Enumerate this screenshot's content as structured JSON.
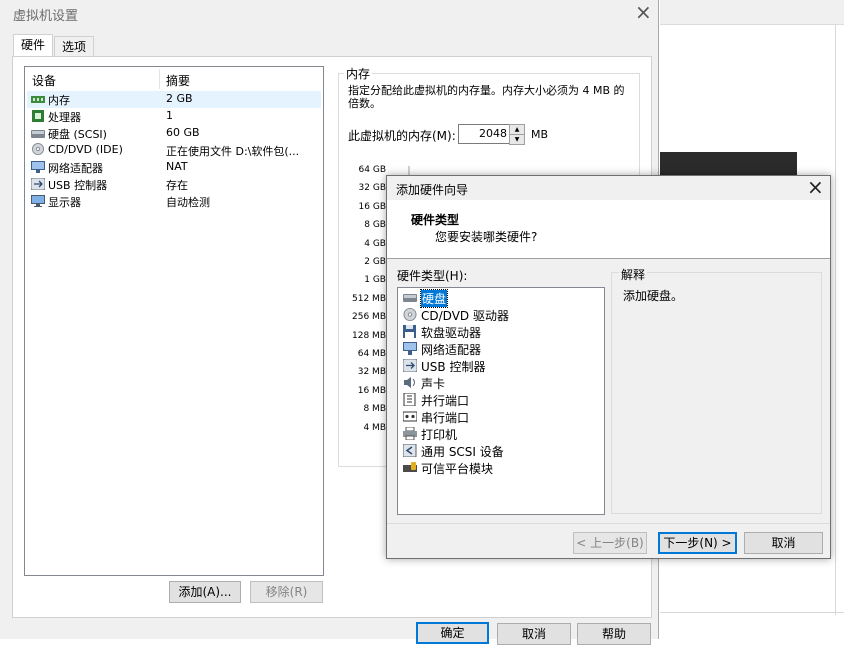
{
  "settings_dialog": {
    "title": "虚拟机设置",
    "tabs": [
      "硬件",
      "选项"
    ],
    "table_headers": {
      "device": "设备",
      "summary": "摘要"
    },
    "devices": [
      {
        "name": "内存",
        "summary": "2 GB",
        "icon": "memory-icon"
      },
      {
        "name": "处理器",
        "summary": "1",
        "icon": "cpu-icon"
      },
      {
        "name": "硬盘 (SCSI)",
        "summary": "60 GB",
        "icon": "harddisk-icon"
      },
      {
        "name": "CD/DVD (IDE)",
        "summary": "正在使用文件 D:\\软件包(...",
        "icon": "cdrom-icon"
      },
      {
        "name": "网络适配器",
        "summary": "NAT",
        "icon": "network-icon"
      },
      {
        "name": "USB 控制器",
        "summary": "存在",
        "icon": "usb-icon"
      },
      {
        "name": "显示器",
        "summary": "自动检测",
        "icon": "display-icon"
      }
    ],
    "add_button": "添加(A)...",
    "remove_button": "移除(R)",
    "ok_button": "确定",
    "cancel_button": "取消",
    "help_button": "帮助",
    "memory": {
      "group_title": "内存",
      "description": "指定分配给此虚拟机的内存量。内存大小必须为 4 MB 的倍数。",
      "field_label": "此虚拟机的内存(M):",
      "value": "2048",
      "unit": "MB",
      "scale_labels": [
        "64 GB",
        "32 GB",
        "16 GB",
        "8 GB",
        "4 GB",
        "2 GB",
        "1 GB",
        "512 MB",
        "256 MB",
        "128 MB",
        "64 MB",
        "32 MB",
        "16 MB",
        "8 MB",
        "4 MB"
      ]
    }
  },
  "wizard": {
    "title": "添加硬件向导",
    "header_title": "硬件类型",
    "header_subtitle": "您要安装哪类硬件?",
    "list_label": "硬件类型(H):",
    "items": [
      {
        "label": "硬盘",
        "icon": "harddisk-icon",
        "selected": true
      },
      {
        "label": "CD/DVD 驱动器",
        "icon": "cdrom-icon"
      },
      {
        "label": "软盘驱动器",
        "icon": "floppy-icon"
      },
      {
        "label": "网络适配器",
        "icon": "network-icon"
      },
      {
        "label": "USB 控制器",
        "icon": "usb-icon"
      },
      {
        "label": "声卡",
        "icon": "speaker-icon"
      },
      {
        "label": "并行端口",
        "icon": "parallel-port-icon"
      },
      {
        "label": "串行端口",
        "icon": "serial-port-icon"
      },
      {
        "label": "打印机",
        "icon": "printer-icon"
      },
      {
        "label": "通用 SCSI 设备",
        "icon": "scsi-icon"
      },
      {
        "label": "可信平台模块",
        "icon": "tpm-icon"
      }
    ],
    "explain_title": "解释",
    "explain_text": "添加硬盘。",
    "back_button": "< 上一步(B)",
    "next_button": "下一步(N) >",
    "cancel_button": "取消"
  }
}
